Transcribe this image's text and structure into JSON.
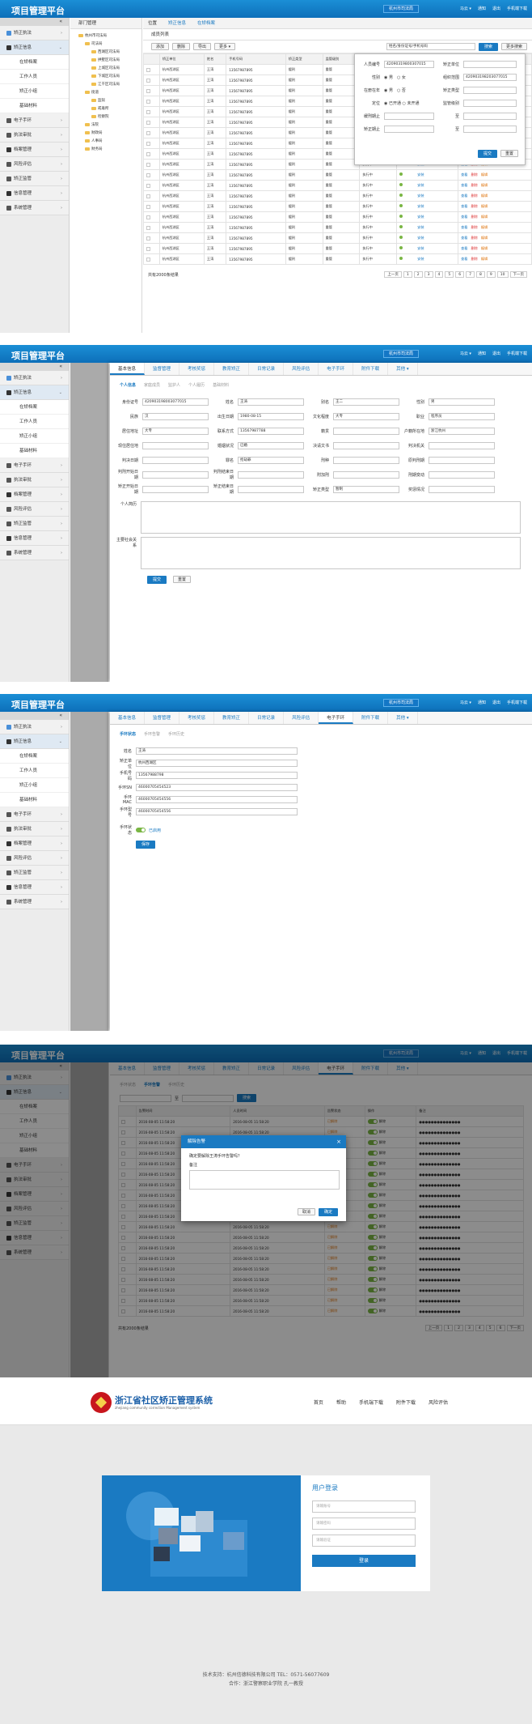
{
  "app": {
    "title": "项目管理平台",
    "org": "杭州市司法局",
    "tools": [
      "马云 ▾",
      "通知",
      "退出",
      "手机端下载"
    ]
  },
  "sidebar": {
    "items": [
      {
        "label": "矫正执法",
        "icon": "people-icon"
      },
      {
        "label": "矫正信息",
        "icon": "file-icon",
        "open": true
      },
      {
        "sub": "在矫档案"
      },
      {
        "sub": "工作人员"
      },
      {
        "sub": "矫正小组"
      },
      {
        "sub": "基础材料"
      },
      {
        "label": "电子手环",
        "icon": "watch-icon"
      },
      {
        "label": "执法审批",
        "icon": "stamp-icon"
      },
      {
        "label": "档案管理",
        "icon": "folder-icon"
      },
      {
        "label": "风险评估",
        "icon": "star-icon"
      },
      {
        "label": "矫正监管",
        "icon": "person-icon"
      },
      {
        "label": "信息管理",
        "icon": "folder-icon"
      },
      {
        "label": "系统管理",
        "icon": "gear-icon"
      }
    ]
  },
  "panel1": {
    "crumbs": [
      "位置",
      "矫正信息",
      "在矫档案"
    ],
    "tree_title": "部门管理",
    "tree": [
      "杭州市司法局",
      "司法局",
      "西湖区司法局",
      "拱墅区司法局",
      "上城区司法局",
      "下城区司法局",
      "江干区司法局",
      "街道",
      "监狱",
      "戒毒所",
      "检察院",
      "法院",
      "财政局",
      "人事局",
      "财务局"
    ],
    "list_title": "成员列表",
    "toolbar": [
      "添加",
      "删除",
      "导出",
      "更多 ▾"
    ],
    "search_placeholder": "姓名/身份证号/手机号码",
    "search_btn": "搜索",
    "adv_btn": "更多搜索",
    "columns": [
      "",
      "矫正单位",
      "姓名",
      "手机号码",
      "矫正类型",
      "监管级别",
      "矫正状态",
      "手机定位",
      "操作"
    ],
    "rows": [
      [
        "杭州西湖区",
        "王涛",
        "13567987895",
        "缓刑",
        "重管",
        "执行中"
      ],
      [
        "杭州西湖区",
        "王涛",
        "13567987895",
        "缓刑",
        "重管",
        "执行中"
      ],
      [
        "杭州西湖区",
        "王涛",
        "13567987895",
        "缓刑",
        "重管",
        "执行中"
      ],
      [
        "杭州西湖区",
        "王涛",
        "13567987895",
        "缓刑",
        "重管",
        "执行中"
      ],
      [
        "杭州西湖区",
        "王涛",
        "13567987895",
        "缓刑",
        "重管",
        "执行中"
      ],
      [
        "杭州西湖区",
        "王涛",
        "13567987895",
        "缓刑",
        "重管",
        "执行中"
      ],
      [
        "杭州西湖区",
        "王涛",
        "13567987895",
        "缓刑",
        "重管",
        "执行中"
      ],
      [
        "杭州西湖区",
        "王涛",
        "13567987895",
        "缓刑",
        "重管",
        "执行中"
      ],
      [
        "杭州西湖区",
        "王涛",
        "13567987895",
        "缓刑",
        "重管",
        "执行中"
      ],
      [
        "杭州西湖区",
        "王涛",
        "13567987895",
        "缓刑",
        "重管",
        "执行中"
      ],
      [
        "杭州西湖区",
        "王涛",
        "13567987895",
        "缓刑",
        "重管",
        "执行中"
      ],
      [
        "杭州西湖区",
        "王涛",
        "13567987895",
        "缓刑",
        "重管",
        "执行中"
      ],
      [
        "杭州西湖区",
        "王涛",
        "13567987895",
        "缓刑",
        "重管",
        "执行中"
      ],
      [
        "杭州西湖区",
        "王涛",
        "13567987895",
        "缓刑",
        "重管",
        "执行中"
      ],
      [
        "杭州西湖区",
        "王涛",
        "13567987895",
        "缓刑",
        "重管",
        "执行中"
      ],
      [
        "杭州西湖区",
        "王涛",
        "13567987895",
        "缓刑",
        "重管",
        "执行中"
      ],
      [
        "杭州西湖区",
        "王涛",
        "13567987895",
        "缓刑",
        "重管",
        "执行中"
      ],
      [
        "杭州西湖区",
        "王涛",
        "13567987895",
        "缓刑",
        "重管",
        "执行中"
      ],
      [
        "杭州西湖区",
        "王涛",
        "13567987895",
        "缓刑",
        "重管",
        "执行中"
      ]
    ],
    "ops": [
      "查看",
      "删除",
      "编辑"
    ],
    "status": "安装",
    "total": "共有2000条结果",
    "pager": [
      "上一页",
      "1",
      "2",
      "3",
      "4",
      "5",
      "6",
      "7",
      "8",
      "9",
      "10",
      "下一页"
    ],
    "adv": {
      "id_label": "人员编号",
      "id_val": "42090319800307015",
      "unit_label": "矫正单位",
      "sex_label": "性别",
      "sex_opts": [
        "男",
        "女"
      ],
      "phone_label": "组织范围",
      "phone_val": "420903198203077015",
      "type_label": "在册在年",
      "type_opts": [
        "男",
        "否"
      ],
      "stat_label": "矫正类型",
      "pos_label": "定位",
      "pos_opts": [
        "已开通",
        "未开通"
      ],
      "level_label": "监管级别",
      "d1": "缓刑期止",
      "d2": "矫正期止",
      "to": "至",
      "ok": "提交",
      "reset": "重置"
    }
  },
  "panel2": {
    "tabs": [
      "基本信息",
      "监督管理",
      "考核奖惩",
      "教育矫正",
      "日常记录",
      "风险评估",
      "电子手环",
      "附件下载",
      "其他 ▾"
    ],
    "subtabs": [
      "个人信息",
      "家庭成员",
      "监护人",
      "个人履历",
      "基础材料"
    ],
    "fields": [
      [
        "身份证号",
        "420903198003077015",
        "姓名",
        "王涛",
        "别名",
        "王二",
        "性别",
        "男"
      ],
      [
        "民族",
        "汉",
        "出生日期",
        "1980-08-15",
        "文化程度",
        "大专",
        "职业",
        "程序员"
      ],
      [
        "居住地址",
        "大专",
        "联系方式",
        "13567987788",
        "籍贯",
        "",
        "户籍所在地",
        "浙江杭州"
      ],
      [
        "现住居住地",
        "",
        "婚姻状况",
        "已婚",
        "决请文书",
        "",
        "判决机关",
        ""
      ],
      [
        "判决日期",
        "",
        "罪名",
        "抢劫罪",
        "刑种",
        "",
        "原判刑期",
        ""
      ],
      [
        "判刑开始日期",
        "",
        "判刑结束日期",
        "",
        "附加刑",
        "",
        "刑期变动",
        ""
      ],
      [
        "矫正开始日期",
        "",
        "矫正结束日期",
        "",
        "矫正类型",
        "暂制",
        "奖惩情况",
        ""
      ]
    ],
    "resume_label": "个人简历",
    "fam_label": "主要社会关系",
    "submit": "提交",
    "reset": "重置"
  },
  "panel3": {
    "subtabs": [
      "手环状态",
      "手环告警",
      "手环历史"
    ],
    "fields": [
      [
        "姓名",
        "王涛"
      ],
      [
        "矫正单位",
        "杭州西湖区"
      ],
      [
        "手机号码",
        "13567988798"
      ],
      [
        "手环SN",
        "46000705454523"
      ],
      [
        "手环MAC",
        "46000705454556"
      ],
      [
        "手环型号",
        "46000705454556"
      ]
    ],
    "switch_label": "手环状态",
    "switch_val": "已启用",
    "save": "保存"
  },
  "panel4": {
    "subtabs": [
      "手环状态",
      "手环告警",
      "手环历史"
    ],
    "date_to": "至",
    "search": "搜索",
    "columns": [
      "",
      "告警时间",
      "人员时间",
      "告警状态",
      "操作",
      "备注"
    ],
    "time": "2016-08-05 11:58:20",
    "status": "已解除",
    "op": "解除",
    "note": "●●●●●●●●●●●●●●",
    "modal": {
      "title": "解除告警",
      "body": "确定要解除王涛手环告警吗？",
      "note_label": "备注",
      "cancel": "取消",
      "ok": "确定"
    },
    "total": "共有2000条结果",
    "pager": [
      "上一页",
      "1",
      "2",
      "3",
      "4",
      "5",
      "6",
      "下一页"
    ]
  },
  "panel5": {
    "brand": "浙江省社区矫正管理系统",
    "brand_en": "zhejiang community correction Management system",
    "nav": [
      "首页",
      "帮助",
      "手机端下载",
      "附件下载",
      "风险评估"
    ],
    "login_title": "用户登录",
    "user_ph": "请输账号",
    "pwd_ph": "请输密码",
    "code_ph": "请输验证",
    "login_btn": "登录",
    "footer1": "技术支持：杭州信德科技有限公司 TEL：0571-56077609",
    "footer2": "合作：浙江警察职业学院 孔一教授"
  }
}
